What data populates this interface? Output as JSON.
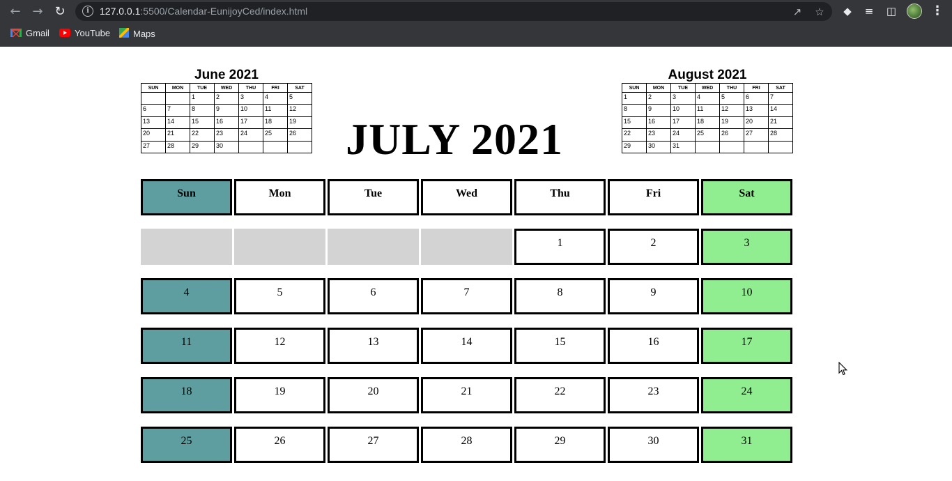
{
  "browser": {
    "url_host": "127.0.0.1",
    "url_rest": ":5500/Calendar-EunijoyCed/index.html",
    "bookmarks": [
      "Gmail",
      "YouTube",
      "Maps"
    ]
  },
  "calendar": {
    "title": "JULY 2021",
    "weekdays": [
      "Sun",
      "Mon",
      "Tue",
      "Wed",
      "Thu",
      "Fri",
      "Sat"
    ],
    "weeks": [
      [
        "",
        "",
        "",
        "",
        "1",
        "2",
        "3"
      ],
      [
        "4",
        "5",
        "6",
        "7",
        "8",
        "9",
        "10"
      ],
      [
        "11",
        "12",
        "13",
        "14",
        "15",
        "16",
        "17"
      ],
      [
        "18",
        "19",
        "20",
        "21",
        "22",
        "23",
        "24"
      ],
      [
        "25",
        "26",
        "27",
        "28",
        "29",
        "30",
        "31"
      ]
    ],
    "colors": {
      "sunday": "#5f9ea0",
      "saturday": "#90ee90",
      "blank": "#d3d3d3"
    }
  },
  "prev_month": {
    "title": "June 2021",
    "weekdays": [
      "SUN",
      "MON",
      "TUE",
      "WED",
      "THU",
      "FRI",
      "SAT"
    ],
    "weeks": [
      [
        "",
        "",
        "1",
        "2",
        "3",
        "4",
        "5"
      ],
      [
        "6",
        "7",
        "8",
        "9",
        "10",
        "11",
        "12"
      ],
      [
        "13",
        "14",
        "15",
        "16",
        "17",
        "18",
        "19"
      ],
      [
        "20",
        "21",
        "22",
        "23",
        "24",
        "25",
        "26"
      ],
      [
        "27",
        "28",
        "29",
        "30",
        "",
        "",
        ""
      ]
    ]
  },
  "next_month": {
    "title": "August 2021",
    "weekdays": [
      "SUN",
      "MON",
      "TUE",
      "WED",
      "THU",
      "FRI",
      "SAT"
    ],
    "weeks": [
      [
        "1",
        "2",
        "3",
        "4",
        "5",
        "6",
        "7"
      ],
      [
        "8",
        "9",
        "10",
        "11",
        "12",
        "13",
        "14"
      ],
      [
        "15",
        "16",
        "17",
        "18",
        "19",
        "20",
        "21"
      ],
      [
        "22",
        "23",
        "24",
        "25",
        "26",
        "27",
        "28"
      ],
      [
        "29",
        "30",
        "31",
        "",
        "",
        "",
        ""
      ]
    ]
  }
}
